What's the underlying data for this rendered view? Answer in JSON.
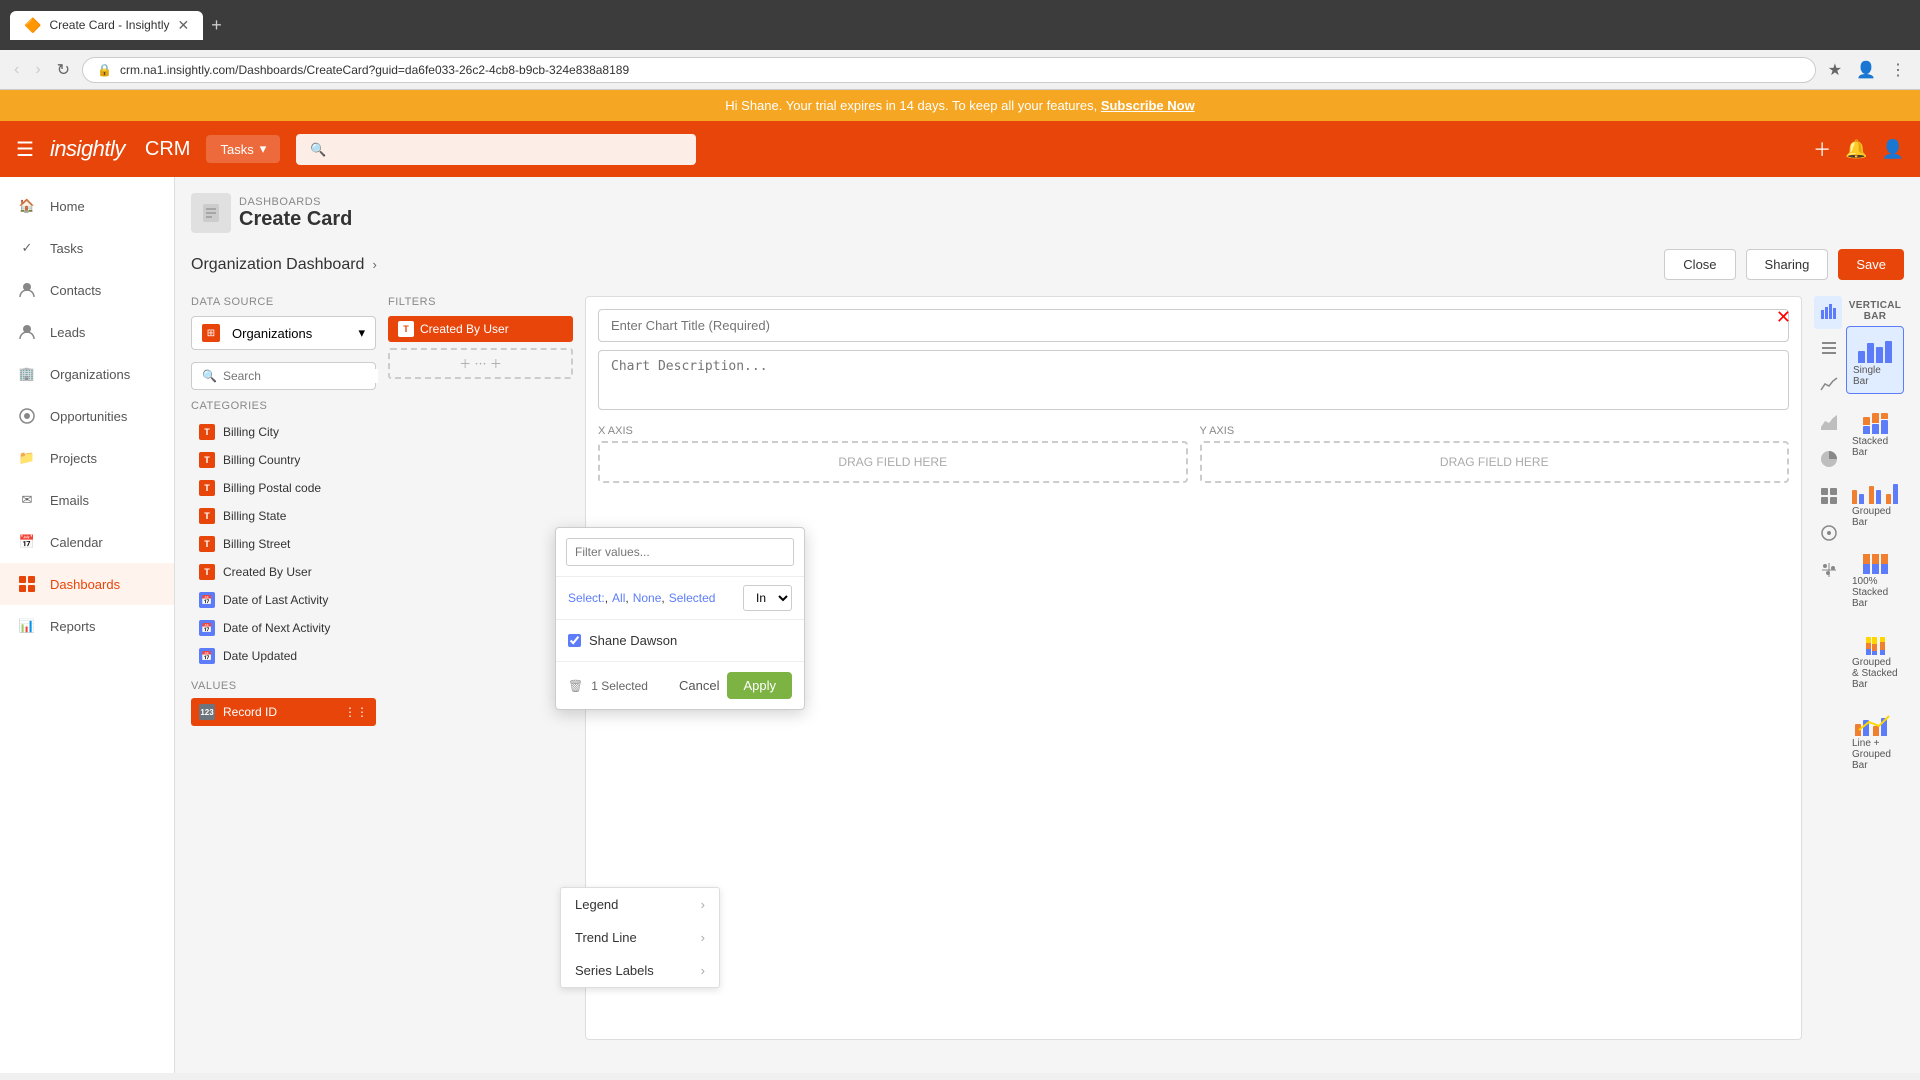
{
  "browser": {
    "tab_title": "Create Card - Insightly",
    "url": "crm.na1.insightly.com/Dashboards/CreateCard?guid=da6fe033-26c2-4cb8-b9cb-324e838a8189",
    "new_tab_label": "+"
  },
  "trial_banner": {
    "text": "Hi Shane. Your trial expires in 14 days. To keep all your features,",
    "link_text": "Subscribe Now"
  },
  "header": {
    "logo": "insightly",
    "app_name": "CRM",
    "tasks_btn": "Tasks",
    "search_placeholder": ""
  },
  "sidebar": {
    "items": [
      {
        "id": "home",
        "label": "Home",
        "icon": "🏠"
      },
      {
        "id": "tasks",
        "label": "Tasks",
        "icon": "✓"
      },
      {
        "id": "contacts",
        "label": "Contacts",
        "icon": "👤"
      },
      {
        "id": "leads",
        "label": "Leads",
        "icon": "👤"
      },
      {
        "id": "organizations",
        "label": "Organizations",
        "icon": "🏢"
      },
      {
        "id": "opportunities",
        "label": "Opportunities",
        "icon": "⊙"
      },
      {
        "id": "projects",
        "label": "Projects",
        "icon": "📁"
      },
      {
        "id": "emails",
        "label": "Emails",
        "icon": "✉"
      },
      {
        "id": "calendar",
        "label": "Calendar",
        "icon": "📅"
      },
      {
        "id": "dashboards",
        "label": "Dashboards",
        "icon": "⊞",
        "active": true
      },
      {
        "id": "reports",
        "label": "Reports",
        "icon": "📊"
      }
    ]
  },
  "breadcrumb": {
    "parent": "DASHBOARDS",
    "title": "Create Card"
  },
  "page": {
    "dashboard_link": "Organization Dashboard",
    "close_btn": "Close",
    "sharing_btn": "Sharing",
    "save_btn": "Save"
  },
  "data_source": {
    "label": "DATA SOURCE",
    "selected": "Organizations",
    "search_placeholder": "Search",
    "categories_title": "CATEGORIES",
    "categories": [
      {
        "id": "billing-city",
        "label": "Billing City",
        "type": "text"
      },
      {
        "id": "billing-country",
        "label": "Billing Country",
        "type": "text"
      },
      {
        "id": "billing-postal",
        "label": "Billing Postal code",
        "type": "text"
      },
      {
        "id": "billing-state",
        "label": "Billing State",
        "type": "text"
      },
      {
        "id": "billing-street",
        "label": "Billing Street",
        "type": "text"
      },
      {
        "id": "created-by-user",
        "label": "Created By User",
        "type": "text"
      },
      {
        "id": "date-last-activity",
        "label": "Date of Last Activity",
        "type": "date"
      },
      {
        "id": "date-next-activity",
        "label": "Date of Next Activity",
        "type": "date"
      },
      {
        "id": "date-updated",
        "label": "Date Updated",
        "type": "date"
      }
    ],
    "values_title": "VALUES",
    "values": [
      {
        "id": "record-id",
        "label": "Record ID",
        "type": "num"
      }
    ]
  },
  "filters": {
    "title": "FILTERS",
    "active_filter": "Created By User"
  },
  "chart": {
    "title_placeholder": "Enter Chart Title (Required)",
    "desc_placeholder": "Chart Description...",
    "x_axis_label": "X AXIS",
    "y_axis_label": "Y AXIS",
    "x_drop_text": "DRAG FIELD HERE",
    "y_drop_text": "DRAG FIELD HERE"
  },
  "filter_popup": {
    "search_placeholder": "Filter values...",
    "select_label": "Select:",
    "select_all": "All",
    "select_none": "None",
    "select_selected": "Selected",
    "in_option": "In",
    "items": [
      {
        "id": "shane-dawson",
        "label": "Shane Dawson",
        "checked": true
      }
    ],
    "count_label": "1 Selected",
    "cancel_btn": "Cancel",
    "apply_btn": "Apply"
  },
  "context_menu": {
    "items": [
      {
        "id": "legend",
        "label": "Legend",
        "has_arrow": true
      },
      {
        "id": "trend-line",
        "label": "Trend Line",
        "has_arrow": true
      },
      {
        "id": "series-labels",
        "label": "Series Labels",
        "has_arrow": true
      }
    ]
  },
  "chart_types": {
    "items": [
      {
        "id": "vertical-bar",
        "label": "VERTICAL BAR",
        "is_icon": true
      },
      {
        "id": "single-bar",
        "label": "Single Bar",
        "active": true
      },
      {
        "id": "stacked-bar",
        "label": "Stacked Bar"
      },
      {
        "id": "grouped-bar",
        "label": "Grouped Bar"
      },
      {
        "id": "100-stacked-bar",
        "label": "100% Stacked Bar"
      },
      {
        "id": "grouped-stacked-bar",
        "label": "Grouped & Stacked Bar"
      },
      {
        "id": "line-grouped-bar",
        "label": "Line + Grouped Bar"
      }
    ],
    "sidebar_icons": [
      {
        "id": "bar-chart-icon",
        "icon": "📊"
      },
      {
        "id": "list-icon",
        "icon": "☰"
      },
      {
        "id": "trend-icon",
        "icon": "📈"
      },
      {
        "id": "area-icon",
        "icon": "📉"
      },
      {
        "id": "pie-icon",
        "icon": "⬤"
      },
      {
        "id": "grid-icon",
        "icon": "⊞"
      },
      {
        "id": "gauge-icon",
        "icon": "◎"
      },
      {
        "id": "scatter-icon",
        "icon": "⊹"
      }
    ]
  }
}
